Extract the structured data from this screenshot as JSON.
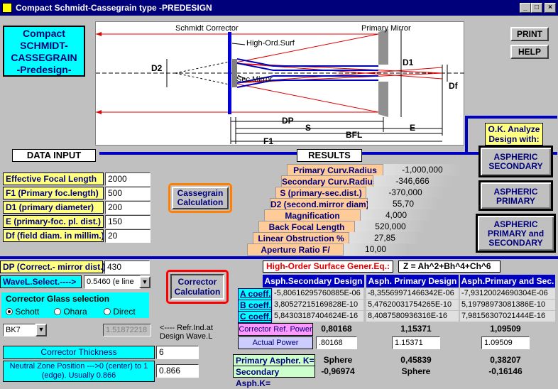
{
  "window": {
    "title": "Compact Schmidt-Cassegrain type  -PREDESIGN",
    "minimize": "_",
    "maximize": "□",
    "close": "×"
  },
  "app_title": {
    "line1": "Compact",
    "line2": "SCHMIDT-",
    "line3": "CASSEGRAIN",
    "line4": "-Predesign-"
  },
  "buttons": {
    "print": "PRINT",
    "help": "HELP",
    "cassegrain_calc_1": "Cassegrain",
    "cassegrain_calc_2": "Calculation",
    "corrector_calc_1": "Corrector",
    "corrector_calc_2": "Calculation"
  },
  "diagram": {
    "schmidt_corrector": "Schmidt Corrector",
    "primary_mirror": "Primary Mirror",
    "high_ord_surf": "High-Ord.Surf",
    "sec_mirror": "Sec.Mirror",
    "d2": "D2",
    "d1": "D1",
    "df": "Df",
    "dp": "DP",
    "s": "S",
    "bfl": "BFL",
    "e": "E",
    "f1": "F1"
  },
  "data_input": {
    "header": "DATA INPUT",
    "fields": [
      {
        "label": "Effective Focal Length",
        "value": "2000"
      },
      {
        "label": "F1 (Primary foc.length)",
        "value": "500"
      },
      {
        "label": "D1 (primary diameter)",
        "value": "200"
      },
      {
        "label": "E (primary-foc. pl. dist.)",
        "value": "150"
      },
      {
        "label": "Df (field diam. in millim.)",
        "value": "20"
      }
    ]
  },
  "results": {
    "header": "RESULTS",
    "rows": [
      {
        "label": "Primary Curv.Radius",
        "value": "-1,000,000"
      },
      {
        "label": "Secondary Curv.Radius",
        "value": "-346,666"
      },
      {
        "label": "S (primary-sec.dist.)",
        "value": "-370,000"
      },
      {
        "label": "D2 (second.mirror diam)",
        "value": "55,70"
      },
      {
        "label": "Magnification",
        "value": "4,000"
      },
      {
        "label": "Back Focal Length",
        "value": "520,000"
      },
      {
        "label": "Linear Obstruction %",
        "value": "27,85"
      },
      {
        "label": "Aperture Ratio  F/",
        "value": "10,00"
      }
    ]
  },
  "analyze": {
    "title1": "O.K. Analyze",
    "title2": "Design with:",
    "asph_sec_1": "ASPHERIC",
    "asph_sec_2": "SECONDARY",
    "asph_pri_1": "ASPHERIC",
    "asph_pri_2": "PRIMARY",
    "asph_both_1": "ASPHERIC",
    "asph_both_2": "PRIMARY  and",
    "asph_both_3": "SECONDARY"
  },
  "corrector": {
    "dp_label": "DP (Correct.- mirror dist.)",
    "dp_value": "430",
    "wavel_label": "WaveL.Select.---->",
    "wavel_value": "0.5460  (e  line",
    "glass_title": "Corrector Glass selection",
    "glass_options": [
      "Schott",
      "Ohara",
      "Direct"
    ],
    "glass_value": "BK7",
    "refr_index": "1.51872218",
    "refr_note_1": "<---- Refr.Ind.at",
    "refr_note_2": "Design Wave.L",
    "thickness_label": "Corrector Thickness",
    "thickness_value": "6",
    "neutral_label": "Neutral Zone Position --->0 (center) to 1 (edge). Usually 0.866",
    "neutral_value": "0.866"
  },
  "high_order": {
    "title": "High-Order Surface Gener.Eq.:",
    "equation": "Z =  Ah^2+Bh^4+Ch^6",
    "col1": "Asph.Secondary Design",
    "col2": "Asph. Primary Design",
    "col3": "Asph.Primary and Sec.",
    "coef_labels": [
      "A coeff.",
      "B coeff.",
      "C coeff."
    ],
    "sec": [
      "-5,80616295760885E-06",
      "3,80527215169828E-10",
      "5,84303187404624E-16"
    ],
    "pri": [
      "-8,35569971466342E-06",
      "5,47620031754265E-10",
      "8,4087580936316E-16"
    ],
    "both": [
      "-7,93120024690304E-06",
      "5,19798973081386E-10",
      "7,98156307021444E-16"
    ],
    "ref_power_label": "Corrector Ref. Power",
    "ref_power": [
      "0,80168",
      "1,15371",
      "1,09509"
    ],
    "actual_power_label": "Actual Power",
    "actual_power": [
      ".80168",
      "1.15371",
      "1.09509"
    ],
    "k_label_1": "Primary Aspher. K=",
    "k_label_2": "Secondary Asph.K=",
    "k_sec": [
      "Sphere",
      "-0,96974"
    ],
    "k_pri": [
      "0,45839",
      "Sphere"
    ],
    "k_both": [
      "0,38207",
      "-0,16146"
    ]
  },
  "colors": {
    "titlebar": "#00007b",
    "cyan": "#00ffff",
    "yellow": "#ffff80",
    "orange": "#ff8000",
    "red": "#ff0000",
    "blue": "#0000c0"
  }
}
